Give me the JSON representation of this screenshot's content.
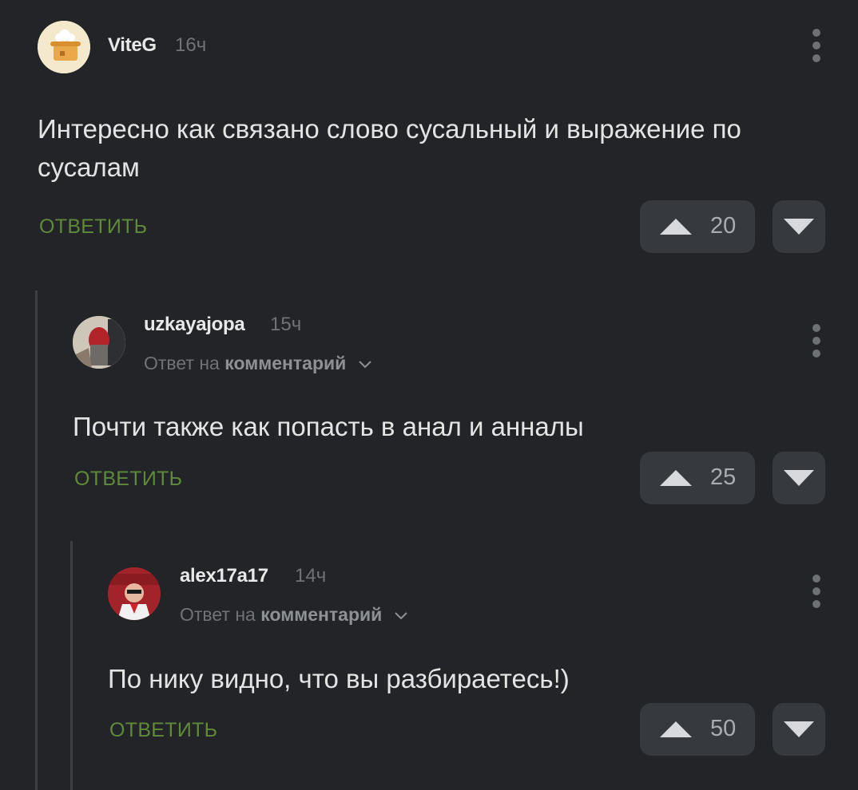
{
  "comments": [
    {
      "username": "ViteG",
      "time": "16ч",
      "text": "Интересно как связано слово сусальный и выражение по сусалам",
      "reply_label": "ОТВЕТИТЬ",
      "votes": "20"
    },
    {
      "username": "uzkayajopa",
      "time": "15ч",
      "reply_prefix": "Ответ на",
      "reply_link": "комментарий",
      "text": "Почти также как попасть в анал и анналы",
      "reply_label": "ОТВЕТИТЬ",
      "votes": "25"
    },
    {
      "username": "alex17a17",
      "time": "14ч",
      "reply_prefix": "Ответ на",
      "reply_link": "комментарий",
      "text": "По нику видно, что вы разбираетесь!)",
      "reply_label": "ОТВЕТИТЬ",
      "votes": "50"
    }
  ],
  "colors": {
    "background": "#222427",
    "reply_button": "#5f8a3b",
    "vote_box": "#36393d",
    "thread_line": "#3c3f43"
  },
  "icons": [
    "avatar",
    "upvote-triangle-icon",
    "downvote-triangle-icon",
    "more-vertical-icon",
    "chevron-down-icon"
  ]
}
